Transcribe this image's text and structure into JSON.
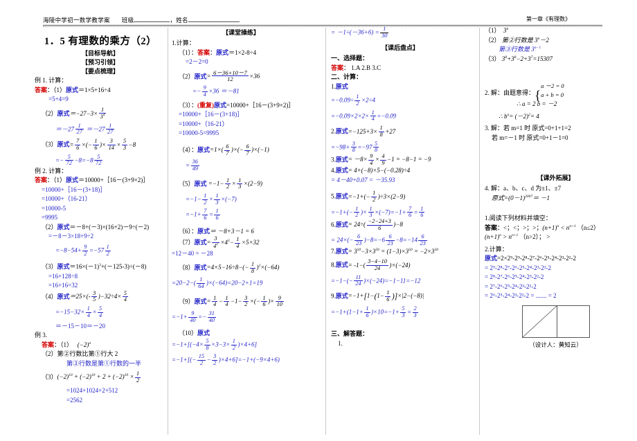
{
  "header": {
    "left_text": "海陵中学初一数学教学案",
    "class_label": "班级",
    "name_label": "姓名",
    "comma": "，",
    "right_text": "第一章《有理数》"
  },
  "col1": {
    "title": "1．5 有理数的乘方（2）",
    "nav1": "【目标导航】",
    "nav2": "【预习引领】",
    "nav3": "【要点梳理】",
    "ex1_label": "例 1. 计算：",
    "answer_label": "答案",
    "colon": "：",
    "yuanshi": "原式",
    "ex1_1": "（1）",
    "ex1_1_body": "＝1×5+16÷4",
    "ex1_1_line2": "=5+4=9",
    "ex1_2": "（2）",
    "ex1_2_res1": "＝－27",
    "ex1_2_res2": "＝－27",
    "ex1_3": "（3）",
    "ex1_3_res": "－8 ＝－8",
    "ex2_label": "例 2. 计算：",
    "ex2_1": "（1）",
    "ex2_1_l1": "＝10000+［16－(3+9×2)］",
    "ex2_1_l2": "=10000+［16－(3+18)］",
    "ex2_1_l3": "=10000+（16-21）",
    "ex2_1_l4": "=10000-5",
    "ex2_1_l5": "=9995",
    "ex2_2": "（2）",
    "ex2_2_l1": "＝－8+(－3)×(16+2)－9÷(－2)",
    "ex2_2_l2": "=－8－3×18+9÷2",
    "ex2_3": "（3）",
    "ex2_3_l1": "＝16×(－1)",
    "ex2_3_l1b": "+(－125-3)÷(－8)",
    "ex2_3_l2": "=16+128÷8",
    "ex2_3_l3": "=16+16=32",
    "ex2_4": "（4）",
    "ex2_4_l3": "＝－15－10＝－20",
    "ex3_label": "例 3.",
    "ex3_1": "（1）",
    "ex3_2": "（2）",
    "ex3_2_l1": "第②行数比第①行大 2",
    "ex3_2_l2": "第③行数是第①行数的一半",
    "ex3_3": "（3）",
    "ex3_3_l2": "=1024+1024+2+512",
    "ex3_3_l3": "=2562"
  },
  "col2": {
    "section": "【课堂操练】",
    "q_label": "1.计算：",
    "q1": "（1）：",
    "answer_label": "答案",
    "colon": "：",
    "yuanshi": "原式",
    "q1_body": "＝1×2-8÷4",
    "q1_l2": "=2－2=0",
    "q2": "（2）",
    "q2_num": "6－36+10－7",
    "q2_den": "12",
    "q2_tail": "×36",
    "q2_l2_tail": "×36",
    "q2_l2_res": "＝－81",
    "q3": "（3）：",
    "q3_dup": "(重复)",
    "q3_l1": "=10000+［16－(3+9×2)］",
    "q3_l2": "=10000+［16－(3+18)］",
    "q3_l3": "=10000+（16-21）",
    "q3_l4": "=10000-5=9995",
    "q4": "（4）：",
    "q5": "（5）",
    "q6": "（6）：",
    "q6_body": "＝ －8+3－1 = 6",
    "q7": "（7）",
    "q7_l2": "=12－40 = －28",
    "q8": "（8）",
    "q9": "（9）",
    "q10": "（10）"
  },
  "col3": {
    "carry_line": "= －1÷(－36+6) =",
    "carry_frac_num": "1",
    "carry_frac_den": "30",
    "section": "【课后盘点】",
    "part1": "一、选择题：",
    "answer_label": "答案",
    "colon": "：",
    "choices": "1.A  2.B  3.C",
    "part2": "二、计算：",
    "yuanshi": "原式",
    "n1": "1.",
    "n2": "2.",
    "n3": "3.",
    "n4": "4.",
    "n5": "5.",
    "n6": "6.",
    "n7": "7.",
    "n8": "8.",
    "n9": "9.",
    "q3_body": "= －8×",
    "q4_l2": "= 4－40+0.07 = －35.93",
    "part3": "三、解答题：",
    "part3_item": "1."
  },
  "col4": {
    "a1": "（1）",
    "a1_body": "3",
    "a2": "（2）",
    "a2_l1": "第②行数是 3",
    "a2_l1b": "－2",
    "a2_l2": "第③行数是 3",
    "a3": "（3）",
    "a3_res": "=15307",
    "item2": "2. 解：由题意得：",
    "item2_e1": "a －2 = 0",
    "item2_e2": "a + b = 0",
    "item2_r": "∴ a = 2  b = －2",
    "item2_r2": "∴ b",
    "item2_r2b": "= (－2)",
    "item2_r2c": "= 4",
    "item3": "3. 解：若 m=1 时    原式=0+1+1=2",
    "item3_l2": "若 m=－1 时   原式=0+1－1=0",
    "section": "【课外拓展】",
    "item4": "4. 解：a、b、c、d 为±1、±7",
    "item4_l2": "原式=(0－1)",
    "item4_l2b": "＝ －1",
    "read": "1.阅读下列材料并填空：",
    "answer_label": "答案",
    "colon": "：",
    "read_ans": "<；<；>；>；",
    "read_ans2": "（n≤2）",
    "read_ans3": "（n>2）；  >",
    "calc2": "2.计算：",
    "yuanshi": "原式",
    "c_l1": "=2×2⁹-2⁹-2⁸-2⁷-2⁶-2⁵-2⁴-2³-2²-2",
    "c_l2": "= 2⁹-2⁸-2⁷-2⁶-2⁵-2⁴-2³-2²-2",
    "c_l3": "= 2⁸-2⁷-2⁶-2⁵-2⁴-2³-2²-2",
    "c_l4": "= 2⁷-2⁶-2⁵-2⁴-2³-2²-2",
    "c_l5": "= 2⁶-2⁵-2⁴-2³-2²-2 = ....... = 2",
    "figure_caption": "（设计人：黄知云）"
  },
  "colors": {
    "blue": "#2323c8",
    "red": "#d40000",
    "rule": "#555555"
  }
}
